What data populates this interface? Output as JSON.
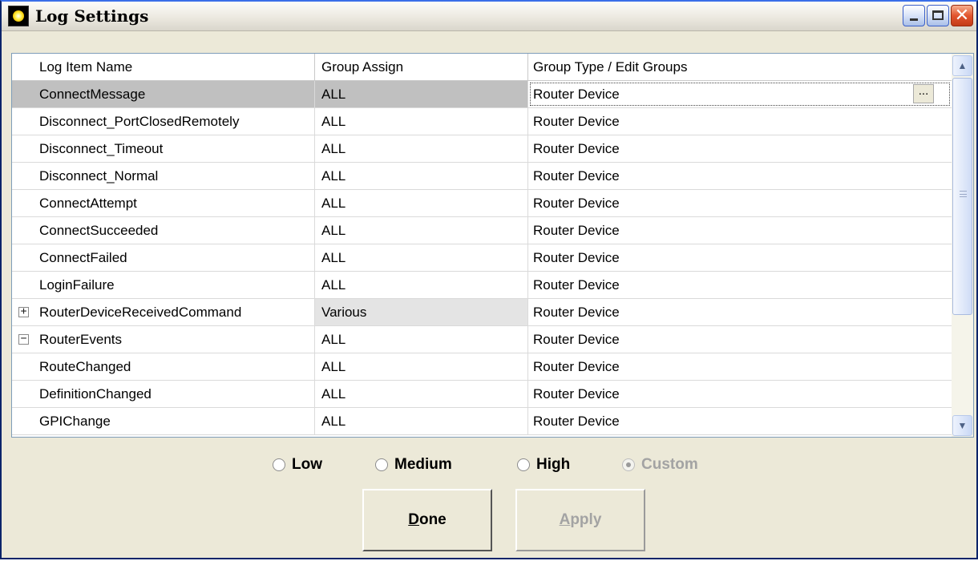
{
  "window": {
    "title": "Log Settings"
  },
  "titlebar_buttons": {
    "minimize_icon": "minimize-icon",
    "maximize_icon": "maximize-icon",
    "close_icon": "close-icon"
  },
  "grid": {
    "columns": [
      "Log Item Name",
      "Group Assign",
      "Group Type / Edit Groups"
    ],
    "rows": [
      {
        "name": "ConnectMessage",
        "group": "ALL",
        "type": "Router Device",
        "expander": "−",
        "selected": true
      },
      {
        "name": "Disconnect_PortClosedRemotely",
        "group": "ALL",
        "type": "Router Device"
      },
      {
        "name": "Disconnect_Timeout",
        "group": "ALL",
        "type": "Router Device"
      },
      {
        "name": "Disconnect_Normal",
        "group": "ALL",
        "type": "Router Device"
      },
      {
        "name": "ConnectAttempt",
        "group": "ALL",
        "type": "Router Device"
      },
      {
        "name": "ConnectSucceeded",
        "group": "ALL",
        "type": "Router Device"
      },
      {
        "name": "ConnectFailed",
        "group": "ALL",
        "type": "Router Device"
      },
      {
        "name": "LoginFailure",
        "group": "ALL",
        "type": "Router Device"
      },
      {
        "name": "RouterDeviceReceivedCommand",
        "group": "Various",
        "type": "Router Device",
        "expander": "+"
      },
      {
        "name": "RouterEvents",
        "group": "ALL",
        "type": "Router Device",
        "expander": "−"
      },
      {
        "name": "RouteChanged",
        "group": "ALL",
        "type": "Router Device"
      },
      {
        "name": "DefinitionChanged",
        "group": "ALL",
        "type": "Router Device"
      },
      {
        "name": "GPIChange",
        "group": "ALL",
        "type": "Router Device"
      }
    ],
    "edit_button_label": "..."
  },
  "levels": {
    "options": [
      "Low",
      "Medium",
      "High",
      "Custom"
    ],
    "selected": "Custom",
    "disabled": [
      "Custom"
    ]
  },
  "buttons": {
    "done": "Done",
    "apply": "Apply"
  },
  "colors": {
    "selected_row": "#c0c0c0",
    "disabled_text": "#a3a3a3",
    "window_face": "#ece9d8"
  }
}
